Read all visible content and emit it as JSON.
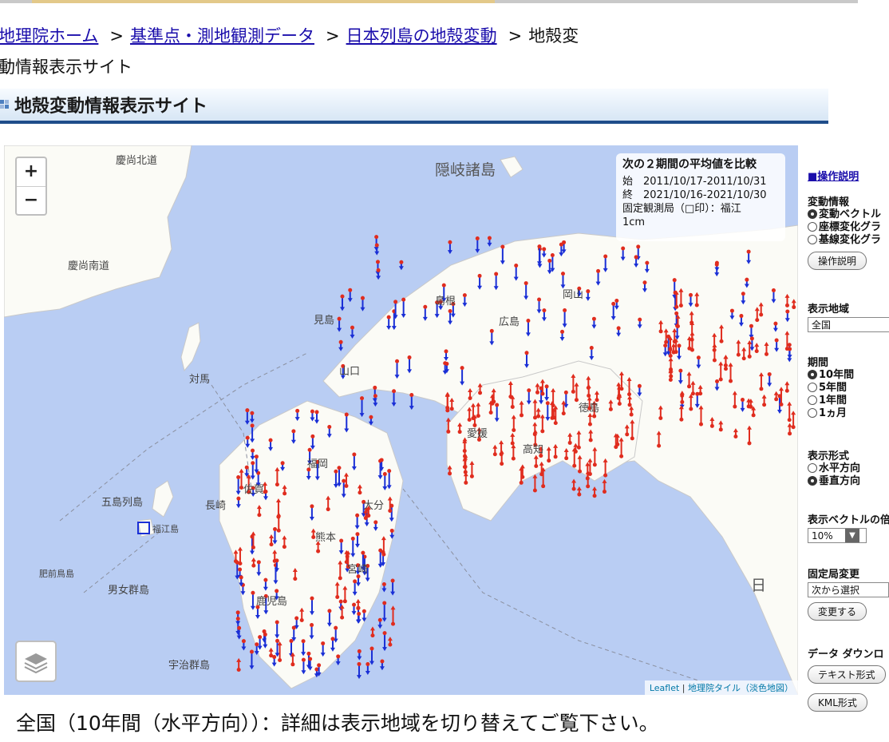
{
  "breadcrumb": {
    "items": [
      "地理院ホーム",
      "基準点・測地観測データ",
      "日本列島の地殻変動"
    ],
    "current_line1": "地殻変",
    "current_line2": "動情報表示サイト",
    "separator": ">"
  },
  "page_title": "地殻変動情報表示サイト",
  "map": {
    "zoom_in": "+",
    "zoom_out": "−",
    "infobox": {
      "title": "次の２期間の平均値を比較",
      "start": "始　2011/10/17-2011/10/31",
      "end": "終　2021/10/16-2021/10/30",
      "fixed_station": "固定観測局（□印）：福江",
      "scale": "1cm"
    },
    "attribution": {
      "leaflet": "Leaflet",
      "tiles": "地理院タイル（淡色地図）"
    },
    "labels": [
      "慶尚北道",
      "慶尚南道",
      "隠岐諸島",
      "日",
      "男女群島",
      "五島列島",
      "宇治群島",
      "対馬",
      "見島",
      "山口",
      "島根",
      "岡山",
      "広島",
      "愛媛",
      "高知",
      "徳島",
      "福岡",
      "大分",
      "熊本",
      "宮崎",
      "鹿児島",
      "長崎",
      "佐賀",
      "肥前鳥島",
      "福江島"
    ],
    "colors": {
      "sea": "#b9cdf3",
      "land": "#fbfbf6",
      "vector_down": "#1a2fd6",
      "vector_up": "#e02c1e",
      "station": "#e02c1e"
    }
  },
  "sidebar": {
    "help_link": "■操作説明",
    "change_info": {
      "label": "変動情報",
      "options": [
        "変動ベクトル",
        "座標変化グラ",
        "基線変化グラ"
      ],
      "selected": "変動ベクトル",
      "button": "操作説明"
    },
    "region": {
      "label": "表示地域",
      "value": "全国"
    },
    "period": {
      "label": "期間",
      "options": [
        "10年間",
        "5年間",
        "1年間",
        "1ヵ月"
      ],
      "selected": "10年間"
    },
    "display_mode": {
      "label": "表示形式",
      "options": [
        "水平方向",
        "垂直方向"
      ],
      "selected": "垂直方向"
    },
    "vector_scale": {
      "label": "表示ベクトルの倍",
      "value": "10%"
    },
    "fixed_change": {
      "label": "固定局変更",
      "value": "次から選択",
      "button": "変更する"
    },
    "download": {
      "label": "データ ダウンロ",
      "text_button": "テキスト形式",
      "kml_button": "KML形式"
    }
  },
  "caption": "全国（10年間（水平方向））：詳細は表示地域を切り替えてご覧下さい。"
}
